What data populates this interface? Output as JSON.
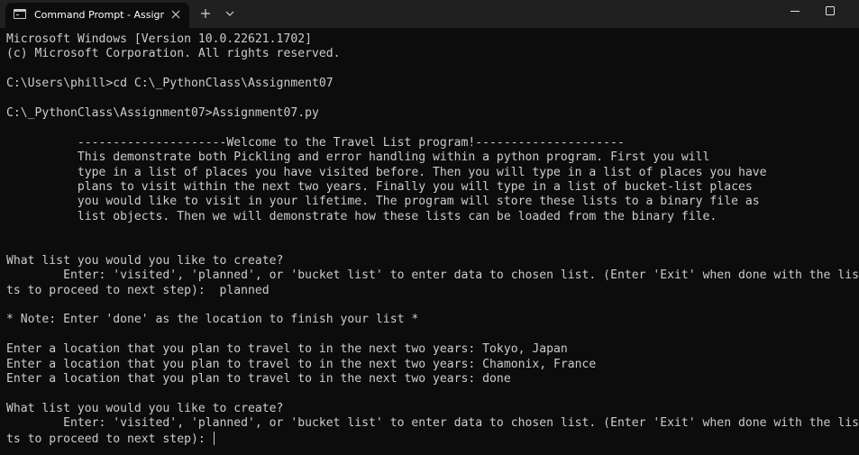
{
  "window": {
    "tab_title": "Command Prompt - Assignme",
    "tab_icon": "terminal-icon",
    "close_icon": "close-icon",
    "new_tab_icon": "plus-icon",
    "dropdown_icon": "chevron-down-icon",
    "minimize_icon": "minimize-icon",
    "maximize_icon": "maximize-icon"
  },
  "terminal": {
    "lines": [
      "Microsoft Windows [Version 10.0.22621.1702]",
      "(c) Microsoft Corporation. All rights reserved.",
      "",
      "C:\\Users\\phill>cd C:\\_PythonClass\\Assignment07",
      "",
      "C:\\_PythonClass\\Assignment07>Assignment07.py",
      "",
      "          ---------------------Welcome to the Travel List program!---------------------",
      "          This demonstrate both Pickling and error handling within a python program. First you will",
      "          type in a list of places you have visited before. Then you will type in a list of places you have",
      "          plans to visit within the next two years. Finally you will type in a list of bucket-list places",
      "          you would like to visit in your lifetime. The program will store these lists to a binary file as",
      "          list objects. Then we will demonstrate how these lists can be loaded from the binary file.",
      "",
      "",
      "What list you would you like to create?",
      "        Enter: 'visited', 'planned', or 'bucket list' to enter data to chosen list. (Enter 'Exit' when done with the lis",
      "ts to proceed to next step):  planned",
      "",
      "* Note: Enter 'done' as the location to finish your list *",
      "",
      "Enter a location that you plan to travel to in the next two years: Tokyo, Japan",
      "Enter a location that you plan to travel to in the next two years: Chamonix, France",
      "Enter a location that you plan to travel to in the next two years: done",
      "",
      "What list you would you like to create?",
      "        Enter: 'visited', 'planned', or 'bucket list' to enter data to chosen list. (Enter 'Exit' when done with the lis",
      "ts to proceed to next step): "
    ]
  }
}
